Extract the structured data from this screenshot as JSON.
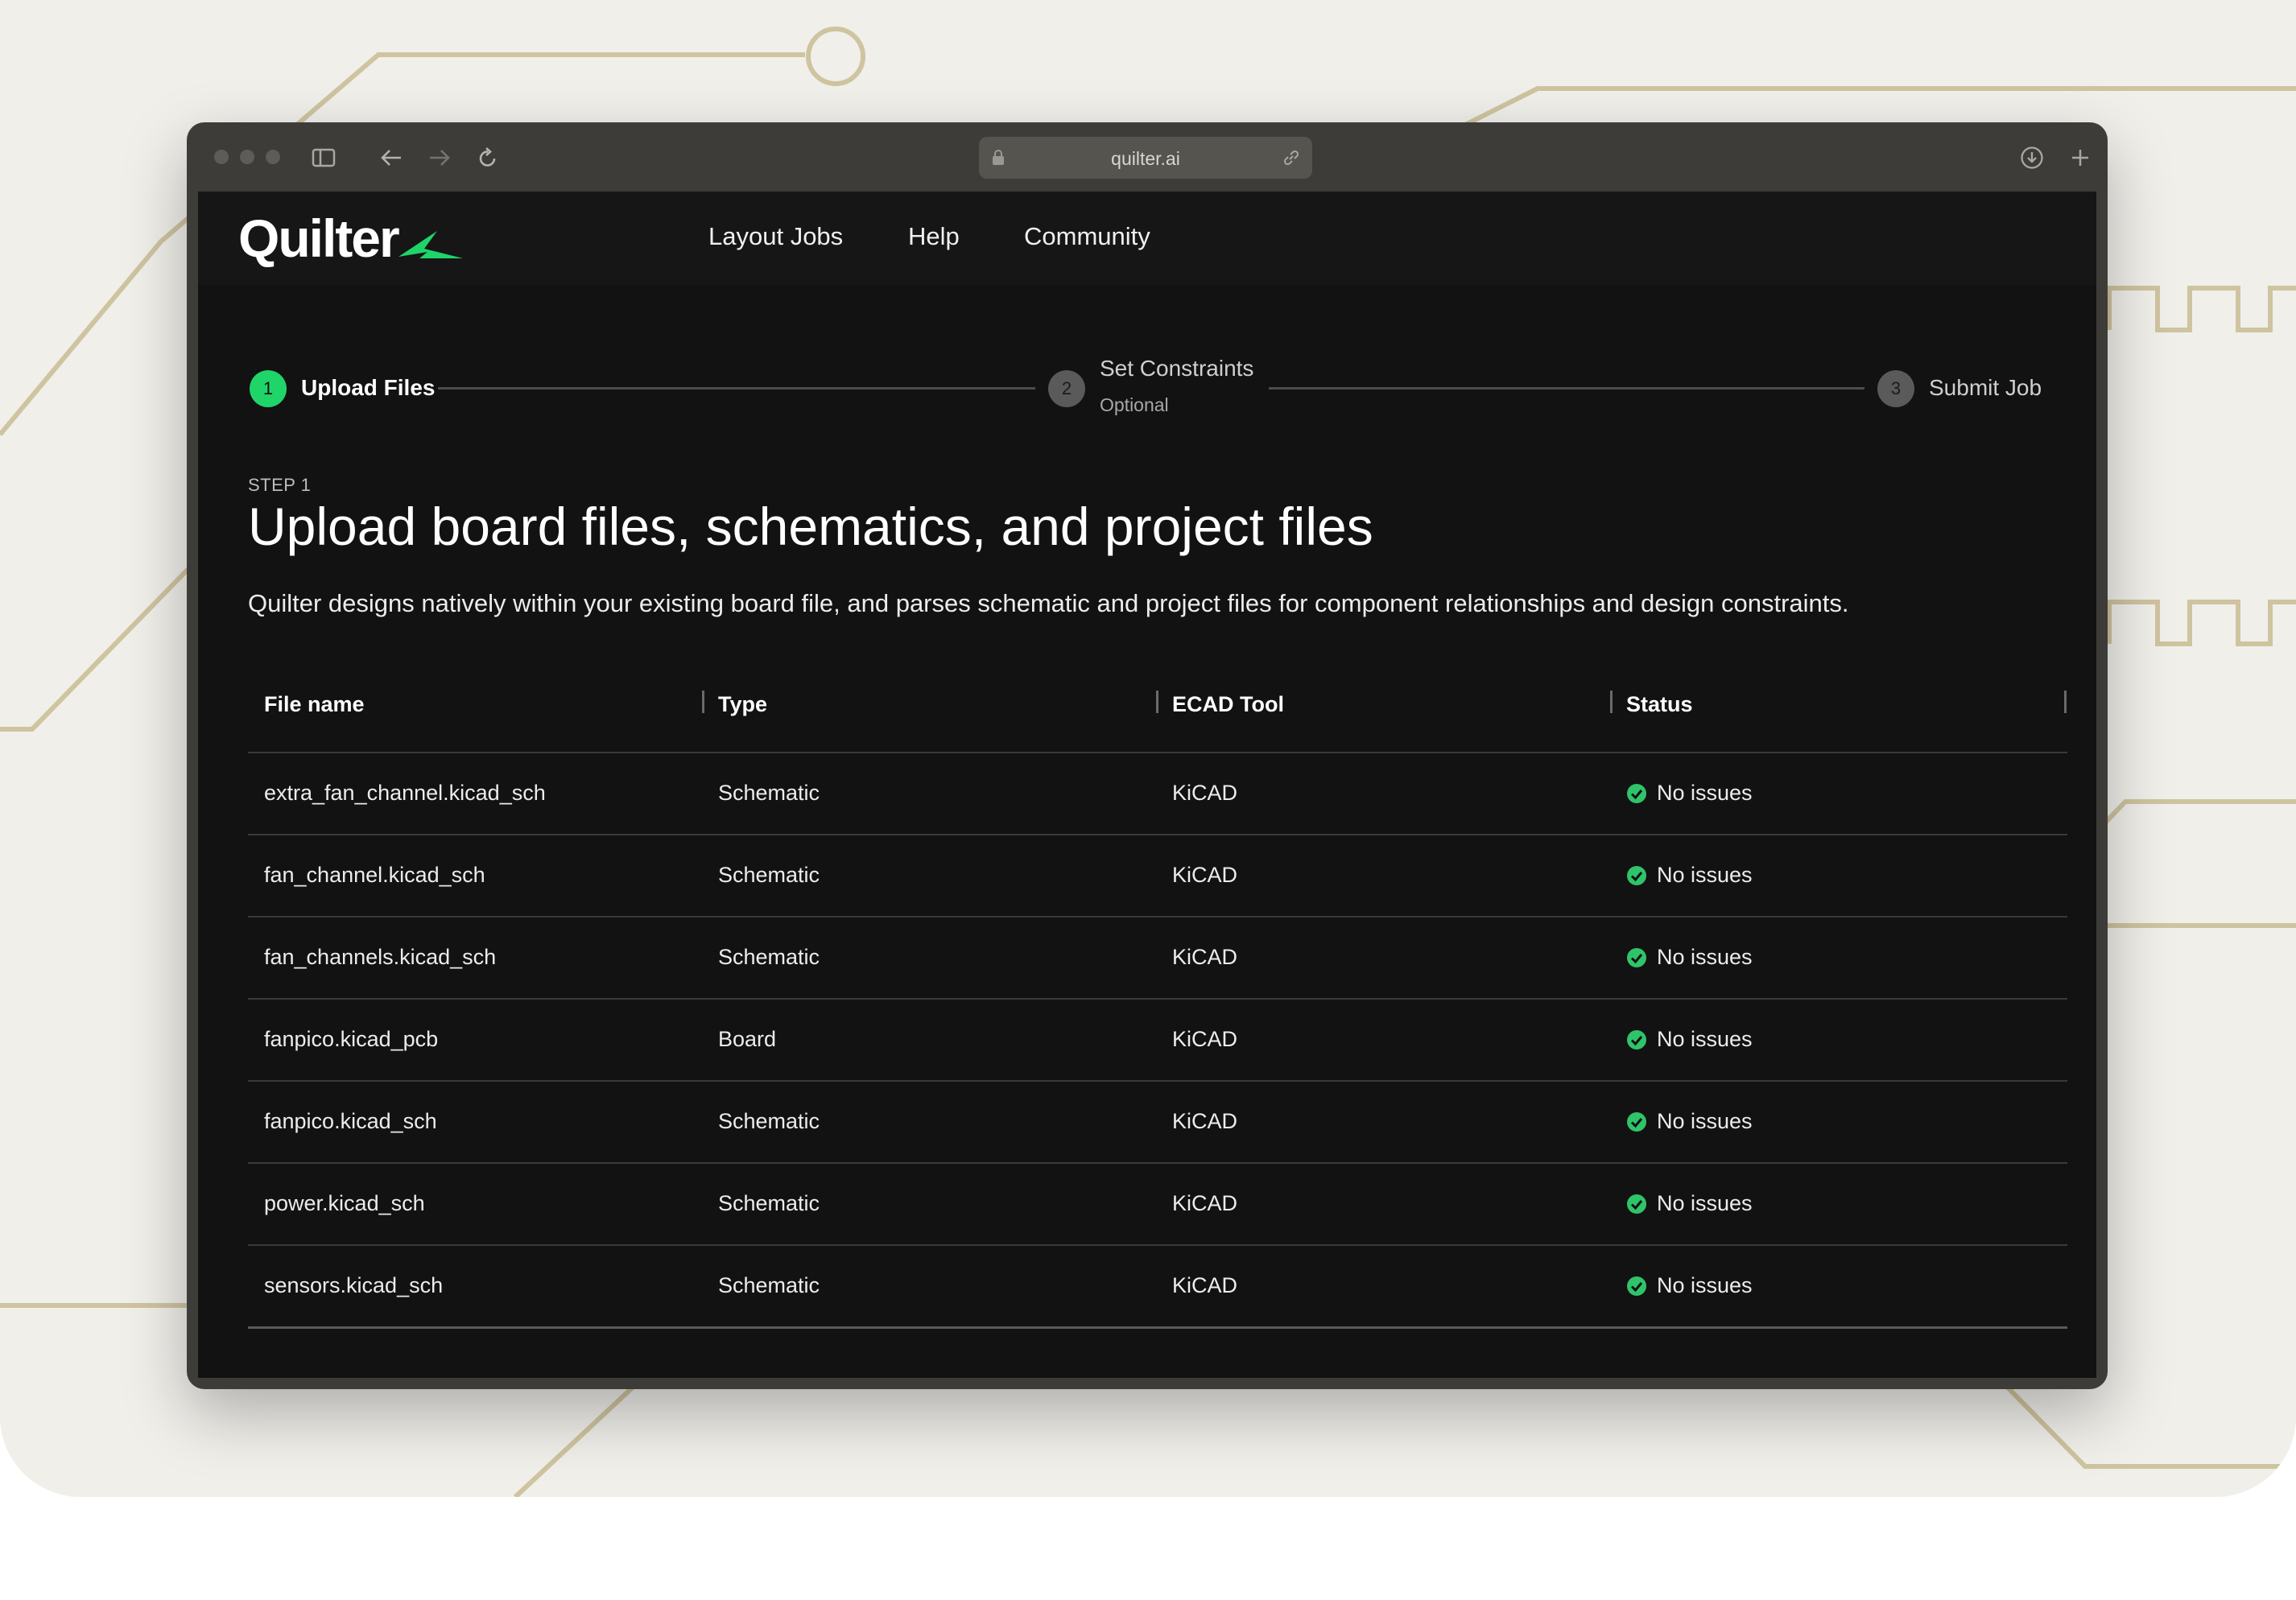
{
  "browser": {
    "url": "quilter.ai"
  },
  "brand": {
    "name": "Quilter",
    "accent": "#1fd56a"
  },
  "nav": {
    "links": [
      "Layout Jobs",
      "Help",
      "Community"
    ]
  },
  "stepper": {
    "steps": [
      {
        "number": "1",
        "label": "Upload Files",
        "sub": "",
        "active": true
      },
      {
        "number": "2",
        "label": "Set Constraints",
        "sub": "Optional",
        "active": false
      },
      {
        "number": "3",
        "label": "Submit Job",
        "sub": "",
        "active": false
      }
    ]
  },
  "content": {
    "eyebrow": "STEP 1",
    "title": "Upload board files, schematics, and project files",
    "description": "Quilter designs natively within your existing board file, and parses schematic and project files for component relationships and design constraints."
  },
  "table": {
    "columns": [
      "File name",
      "Type",
      "ECAD Tool",
      "Status"
    ],
    "rows": [
      {
        "file": "extra_fan_channel.kicad_sch",
        "type": "Schematic",
        "tool": "KiCAD",
        "status": "No issues"
      },
      {
        "file": "fan_channel.kicad_sch",
        "type": "Schematic",
        "tool": "KiCAD",
        "status": "No issues"
      },
      {
        "file": "fan_channels.kicad_sch",
        "type": "Schematic",
        "tool": "KiCAD",
        "status": "No issues"
      },
      {
        "file": "fanpico.kicad_pcb",
        "type": "Board",
        "tool": "KiCAD",
        "status": "No issues"
      },
      {
        "file": "fanpico.kicad_sch",
        "type": "Schematic",
        "tool": "KiCAD",
        "status": "No issues"
      },
      {
        "file": "power.kicad_sch",
        "type": "Schematic",
        "tool": "KiCAD",
        "status": "No issues"
      },
      {
        "file": "sensors.kicad_sch",
        "type": "Schematic",
        "tool": "KiCAD",
        "status": "No issues"
      }
    ],
    "status_color": "#2fc46a"
  },
  "icons": {
    "titlebar": [
      "sidebar-icon",
      "back-arrow-icon",
      "forward-arrow-icon",
      "reload-icon",
      "lock-icon",
      "link-icon",
      "download-icon",
      "plus-icon"
    ],
    "status": "check-circle-icon",
    "logo": "lightning-bolt-icon"
  }
}
